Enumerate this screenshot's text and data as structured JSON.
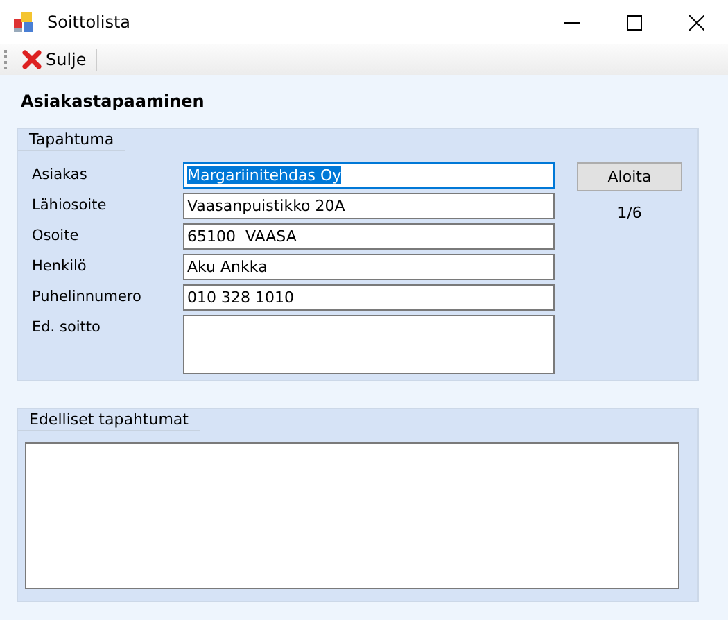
{
  "window": {
    "title": "Soittolista"
  },
  "toolbar": {
    "buttons": [
      {
        "label": "Sulje"
      }
    ]
  },
  "heading": "Asiakastapaaminen",
  "event_group": {
    "title": "Tapahtuma",
    "fields": [
      {
        "label": "Asiakas",
        "value": "Margariinitehdas Oy",
        "kind": "text",
        "focused": true
      },
      {
        "label": "Lähiosoite",
        "value": "Vaasanpuistikko 20A",
        "kind": "text",
        "focused": false
      },
      {
        "label": "Osoite",
        "value": "65100  VAASA",
        "kind": "text",
        "focused": false
      },
      {
        "label": "Henkilö",
        "value": "Aku Ankka",
        "kind": "text",
        "focused": false
      },
      {
        "label": "Puhelinnumero",
        "value": "010 328 1010",
        "kind": "text",
        "focused": false
      },
      {
        "label": "Ed. soitto",
        "kind": "multiline",
        "focused": false
      }
    ],
    "start_button": "Aloita",
    "counter": "1/6"
  },
  "previous_group": {
    "title": "Edelliset tapahtumat"
  }
}
